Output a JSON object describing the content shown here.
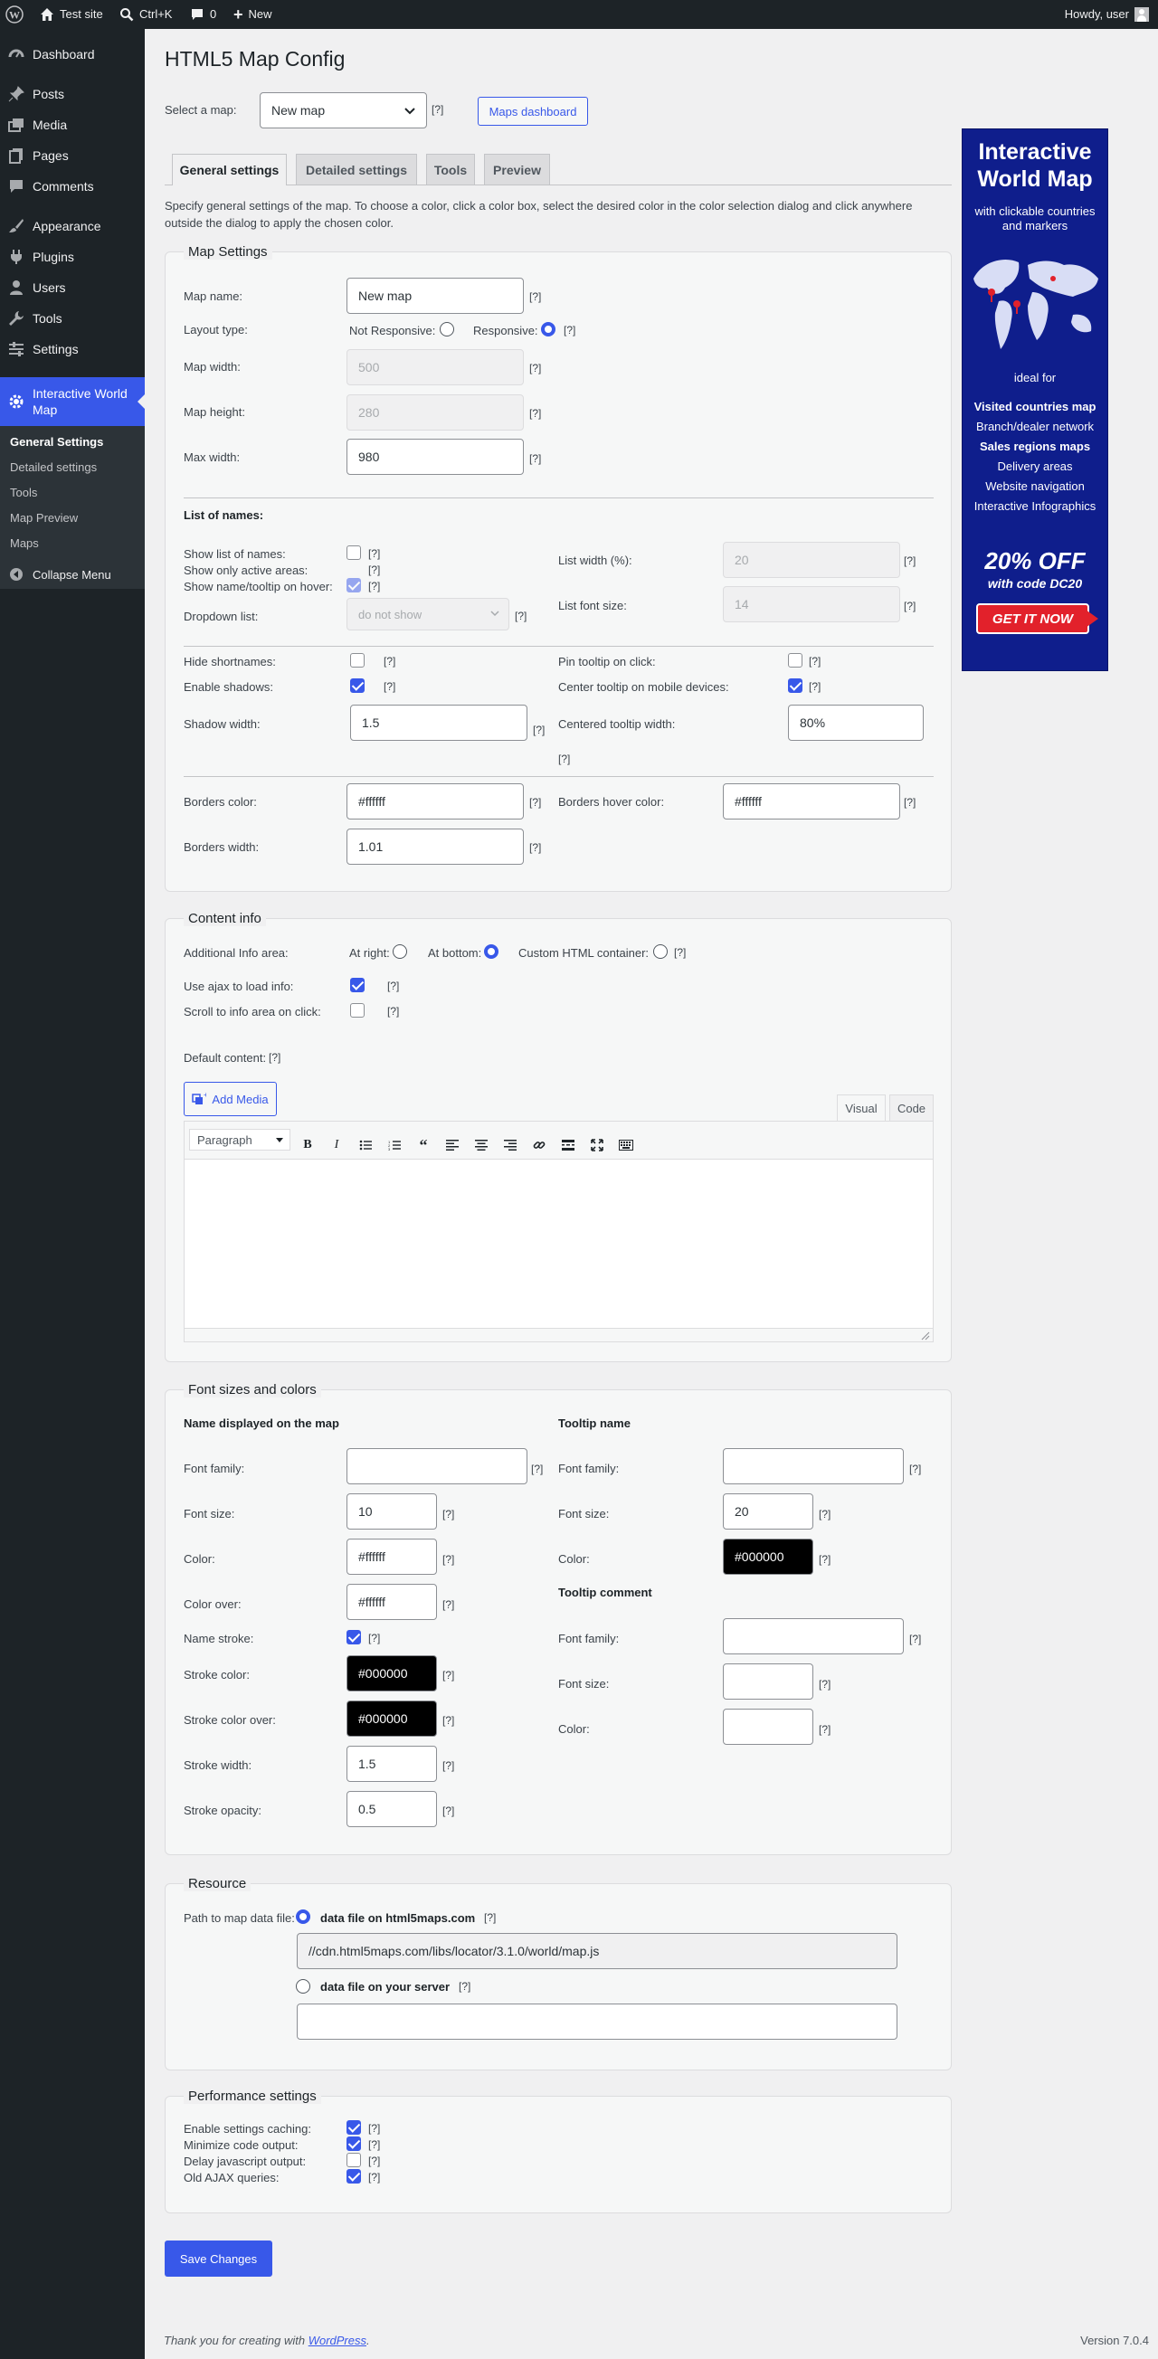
{
  "adminbar": {
    "site": "Test site",
    "search": "Ctrl+K",
    "comments": "0",
    "new": "New",
    "howdy": "Howdy, user"
  },
  "menu": {
    "dashboard": "Dashboard",
    "posts": "Posts",
    "media": "Media",
    "pages": "Pages",
    "comments": "Comments",
    "appearance": "Appearance",
    "plugins": "Plugins",
    "users": "Users",
    "tools": "Tools",
    "settings": "Settings",
    "iwm": "Interactive World Map",
    "sub": [
      "General Settings",
      "Detailed settings",
      "Tools",
      "Map Preview",
      "Maps"
    ],
    "collapse": "Collapse Menu"
  },
  "page": {
    "title": "HTML5 Map Config",
    "select_label": "Select a map:",
    "select_value": "New map",
    "help": "[?]",
    "dashboard_btn": "Maps dashboard"
  },
  "tabs": [
    "General settings",
    "Detailed settings",
    "Tools",
    "Preview"
  ],
  "intro1": "Specify general settings of the map. To choose a color, click a color box, select the desired color in the color selection dialog and click anywhere",
  "intro2": "outside the dialog to apply the chosen color.",
  "map_settings": {
    "title": "Map Settings",
    "map_name": "Map name:",
    "map_name_val": "New map",
    "layout": "Layout type:",
    "not_resp": "Not Responsive:",
    "resp": "Responsive:",
    "width": "Map width:",
    "width_val": "500",
    "height": "Map height:",
    "height_val": "280",
    "max_width": "Max width:",
    "max_width_val": "980",
    "list_names": "List of names:",
    "show_list": "Show list of names:",
    "show_active": "Show only active areas:",
    "show_hover": "Show name/tooltip on hover:",
    "dropdown": "Dropdown list:",
    "dropdown_val": "do not show",
    "list_width": "List width (%):",
    "list_width_val": "20",
    "list_font": "List font size:",
    "list_font_val": "14",
    "hide_short": "Hide shortnames:",
    "enable_shadows": "Enable shadows:",
    "shadow_width": "Shadow width:",
    "shadow_width_val": "1.5",
    "pin_tooltip": "Pin tooltip on click:",
    "center_tooltip": "Center tooltip on mobile devices:",
    "centered_width": "Centered tooltip width:",
    "centered_width_val": "80%",
    "borders_color": "Borders color:",
    "borders_color_val": "#ffffff",
    "borders_hover": "Borders hover color:",
    "borders_hover_val": "#ffffff",
    "borders_width": "Borders width:",
    "borders_width_val": "1.01"
  },
  "content_info": {
    "title": "Content info",
    "area": "Additional Info area:",
    "right": "At right:",
    "bottom": "At bottom:",
    "custom": "Custom HTML container:",
    "ajax": "Use ajax to load info:",
    "scroll": "Scroll to info area on click:",
    "default": "Default content:",
    "add_media": "Add Media",
    "visual": "Visual",
    "code": "Code",
    "paragraph": "Paragraph"
  },
  "fonts": {
    "title": "Font sizes and colors",
    "left_head": "Name displayed on the map",
    "right_head": "Tooltip name",
    "font_family": "Font family:",
    "font_size": "Font size:",
    "color": "Color:",
    "color_over": "Color over:",
    "name_stroke": "Name stroke:",
    "stroke_color": "Stroke color:",
    "stroke_over": "Stroke color over:",
    "stroke_width": "Stroke width:",
    "stroke_opacity": "Stroke opacity:",
    "font_size_val": "10",
    "color_val": "#ffffff",
    "color_over_val": "#ffffff",
    "stroke_color_val": "#000000",
    "stroke_over_val": "#000000",
    "stroke_width_val": "1.5",
    "stroke_opacity_val": "0.5",
    "tt_font_size_val": "20",
    "tt_color_val": "#000000",
    "tt_comment": "Tooltip comment"
  },
  "resource": {
    "title": "Resource",
    "path": "Path to map data file:",
    "opt1": "data file on html5maps.com",
    "url": "//cdn.html5maps.com/libs/locator/3.1.0/world/map.js",
    "opt2": "data file on your server"
  },
  "perf": {
    "title": "Performance settings",
    "caching": "Enable settings caching:",
    "minimize": "Minimize code output:",
    "delay": "Delay javascript output:",
    "ajax": "Old AJAX queries:"
  },
  "save": "Save Changes",
  "footer": {
    "thanks": "Thank you for creating with ",
    "wp": "WordPress",
    "dot": ".",
    "version": "Version 7.0.4"
  },
  "ad": {
    "title": "Interactive World Map",
    "sub": "with clickable countries and markers",
    "ideal": "ideal for",
    "items": [
      "Visited countries map",
      "Branch/dealer network",
      "Sales regions maps",
      "Delivery areas",
      "Website navigation",
      "Interactive Infographics"
    ],
    "off": "20% OFF",
    "code": "with code DC20",
    "cta": "GET IT NOW"
  },
  "colors": {
    "accent": "#3858e9",
    "adminbar": "#1d2327",
    "ad_bg": "#0f1e8c",
    "cta": "#e2212b"
  }
}
